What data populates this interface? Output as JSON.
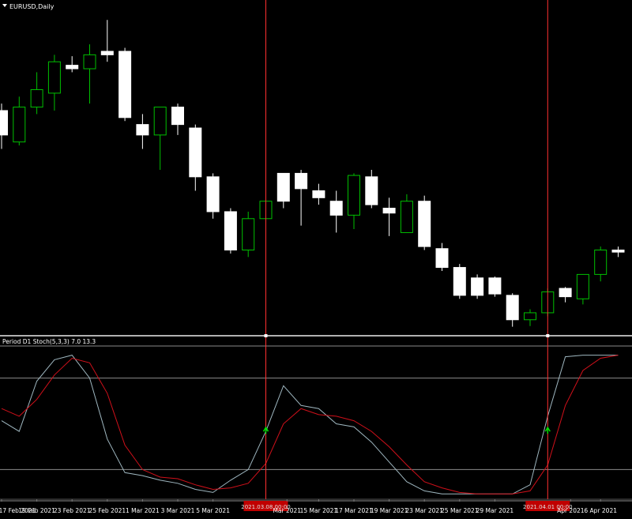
{
  "window": {
    "title": "EURUSD,Daily",
    "menu_icon": "triangle-down-icon"
  },
  "indicator": {
    "label": "Period D1 Stoch(5,3,3) 7.0 13.3",
    "levels": [
      80,
      20
    ]
  },
  "colors": {
    "background": "#000000",
    "bull_candle": "#00c000",
    "bear_candle": "#ffffff",
    "main_line": "#9fb7c0",
    "signal_line": "#d0101a",
    "marker_line": "#ff3030",
    "arrow": "#00e000",
    "separator": "#b0b0b0",
    "level_line": "#8a8a8a"
  },
  "markers": [
    {
      "date_label": "2021.03.08 00:00",
      "candle_index": 15
    },
    {
      "date_label": "2021.04.01 00:00",
      "candle_index": 31
    }
  ],
  "time_axis": [
    "17 Feb 2021",
    "19 Feb 2021",
    "23 Feb 2021",
    "25 Feb 2021",
    "1 Mar 2021",
    "3 Mar 2021",
    "5 Mar 2021",
    "Mar 2021",
    "15 Mar 2021",
    "17 Mar 2021",
    "19 Mar 2021",
    "23 Mar 2021",
    "25 Mar 2021",
    "29 Mar 2021",
    "Apr 2021",
    "6 Apr 2021"
  ],
  "chart_data": {
    "type": "candlestick",
    "symbol": "EURUSD",
    "timeframe": "Daily",
    "candles": [
      {
        "o": 1.2115,
        "h": 1.2125,
        "l": 1.206,
        "c": 1.208
      },
      {
        "o": 1.207,
        "h": 1.2135,
        "l": 1.2065,
        "c": 1.212
      },
      {
        "o": 1.212,
        "h": 1.217,
        "l": 1.211,
        "c": 1.2145
      },
      {
        "o": 1.214,
        "h": 1.2195,
        "l": 1.2115,
        "c": 1.2185
      },
      {
        "o": 1.218,
        "h": 1.2193,
        "l": 1.217,
        "c": 1.2175
      },
      {
        "o": 1.2175,
        "h": 1.221,
        "l": 1.2125,
        "c": 1.2195
      },
      {
        "o": 1.2195,
        "h": 1.2245,
        "l": 1.2185,
        "c": 1.22
      },
      {
        "o": 1.22,
        "h": 1.2205,
        "l": 1.21,
        "c": 1.2105
      },
      {
        "o": 1.2095,
        "h": 1.211,
        "l": 1.206,
        "c": 1.208
      },
      {
        "o": 1.208,
        "h": 1.212,
        "l": 1.203,
        "c": 1.212
      },
      {
        "o": 1.212,
        "h": 1.2125,
        "l": 1.208,
        "c": 1.2095
      },
      {
        "o": 1.209,
        "h": 1.2095,
        "l": 1.2,
        "c": 1.202
      },
      {
        "o": 1.202,
        "h": 1.2025,
        "l": 1.196,
        "c": 1.197
      },
      {
        "o": 1.197,
        "h": 1.1975,
        "l": 1.191,
        "c": 1.1915
      },
      {
        "o": 1.1915,
        "h": 1.197,
        "l": 1.1905,
        "c": 1.196
      },
      {
        "o": 1.196,
        "h": 1.199,
        "l": 1.1945,
        "c": 1.1985
      },
      {
        "o": 1.1985,
        "h": 1.2025,
        "l": 1.1975,
        "c": 1.2025
      },
      {
        "o": 1.2025,
        "h": 1.203,
        "l": 1.195,
        "c": 1.2003
      },
      {
        "o": 1.2,
        "h": 1.201,
        "l": 1.198,
        "c": 1.199
      },
      {
        "o": 1.1985,
        "h": 1.2,
        "l": 1.194,
        "c": 1.1965
      },
      {
        "o": 1.1965,
        "h": 1.2025,
        "l": 1.1945,
        "c": 1.2022
      },
      {
        "o": 1.202,
        "h": 1.203,
        "l": 1.1975,
        "c": 1.198
      },
      {
        "o": 1.1975,
        "h": 1.199,
        "l": 1.1935,
        "c": 1.1968
      },
      {
        "o": 1.194,
        "h": 1.1995,
        "l": 1.194,
        "c": 1.1985
      },
      {
        "o": 1.1985,
        "h": 1.1993,
        "l": 1.1915,
        "c": 1.192
      },
      {
        "o": 1.1917,
        "h": 1.1925,
        "l": 1.1885,
        "c": 1.189
      },
      {
        "o": 1.189,
        "h": 1.1895,
        "l": 1.1845,
        "c": 1.185
      },
      {
        "o": 1.185,
        "h": 1.188,
        "l": 1.1845,
        "c": 1.1875
      },
      {
        "o": 1.1875,
        "h": 1.1877,
        "l": 1.1848,
        "c": 1.1852
      },
      {
        "o": 1.185,
        "h": 1.1853,
        "l": 1.1805,
        "c": 1.1815
      },
      {
        "o": 1.1815,
        "h": 1.183,
        "l": 1.1806,
        "c": 1.1825
      },
      {
        "o": 1.1825,
        "h": 1.186,
        "l": 1.182,
        "c": 1.1855
      },
      {
        "o": 1.186,
        "h": 1.1862,
        "l": 1.184,
        "c": 1.1848
      },
      {
        "o": 1.1845,
        "h": 1.188,
        "l": 1.1837,
        "c": 1.188
      },
      {
        "o": 1.188,
        "h": 1.192,
        "l": 1.187,
        "c": 1.1915
      },
      {
        "o": 1.1915,
        "h": 1.192,
        "l": 1.1905,
        "c": 1.1912
      }
    ],
    "bull_candles": [
      1,
      2,
      3,
      5,
      9,
      14,
      15,
      20,
      23,
      30,
      31,
      33,
      34
    ],
    "price_range": [
      1.18,
      1.226
    ],
    "stoch_main": [
      52,
      45,
      78,
      92,
      95,
      80,
      40,
      18,
      16,
      13,
      11,
      7,
      5,
      13,
      20,
      45,
      75,
      62,
      60,
      50,
      48,
      38,
      25,
      12,
      6,
      4,
      4,
      4,
      4,
      4,
      10,
      55,
      94,
      95,
      95,
      95
    ],
    "stoch_signal": [
      60,
      55,
      66,
      82,
      93,
      90,
      70,
      36,
      20,
      15,
      14,
      10,
      7,
      8,
      11,
      24,
      50,
      60,
      56,
      55,
      52,
      45,
      35,
      23,
      12,
      8,
      5,
      4,
      4,
      4,
      6,
      23,
      62,
      85,
      93,
      95
    ],
    "stoch_range": [
      0,
      100
    ]
  }
}
